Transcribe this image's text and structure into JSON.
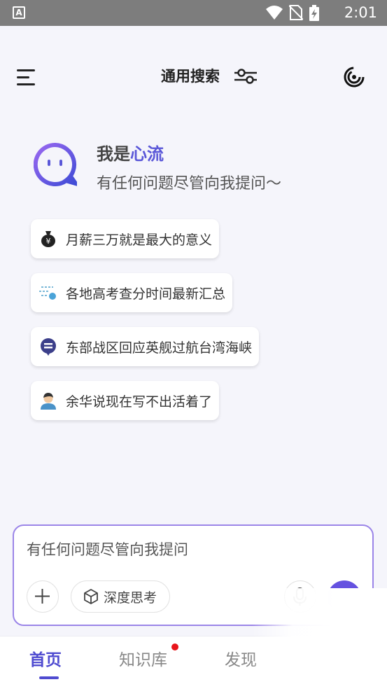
{
  "status_bar": {
    "app_badge": "A",
    "time": "2:01",
    "icons": [
      "wifi-icon",
      "no-sim-icon",
      "battery-charging-icon"
    ]
  },
  "header": {
    "title": "通用搜索",
    "icons": [
      "menu-icon",
      "filter-sliders-icon",
      "swirl-logo-icon"
    ]
  },
  "greeting": {
    "title_prefix": "我是",
    "brand": "心流",
    "subtitle": "有任何问题尽管向我提问～"
  },
  "suggestions": [
    {
      "icon": "money-bag-icon",
      "text": "月薪三万就是最大的意义"
    },
    {
      "icon": "search-list-icon",
      "text": "各地高考查分时间最新汇总"
    },
    {
      "icon": "chat-bubble-icon",
      "text": "东部战区回应英舰过航台湾海峡"
    },
    {
      "icon": "person-avatar-icon",
      "text": "余华说现在写不出活着了"
    }
  ],
  "input": {
    "placeholder": "有任何问题尽管向我提问",
    "deep_think_label": "深度思考"
  },
  "bottom_nav": {
    "items": [
      {
        "label": "首页",
        "active": true
      },
      {
        "label": "知识库",
        "badge_dot": true
      },
      {
        "label": "发现"
      }
    ]
  },
  "colors": {
    "accent": "#4f4bd0",
    "brand": "#5a57d8",
    "call_button": "#6552e0",
    "input_border": "#9b85e8",
    "badge": "#e8151b"
  }
}
